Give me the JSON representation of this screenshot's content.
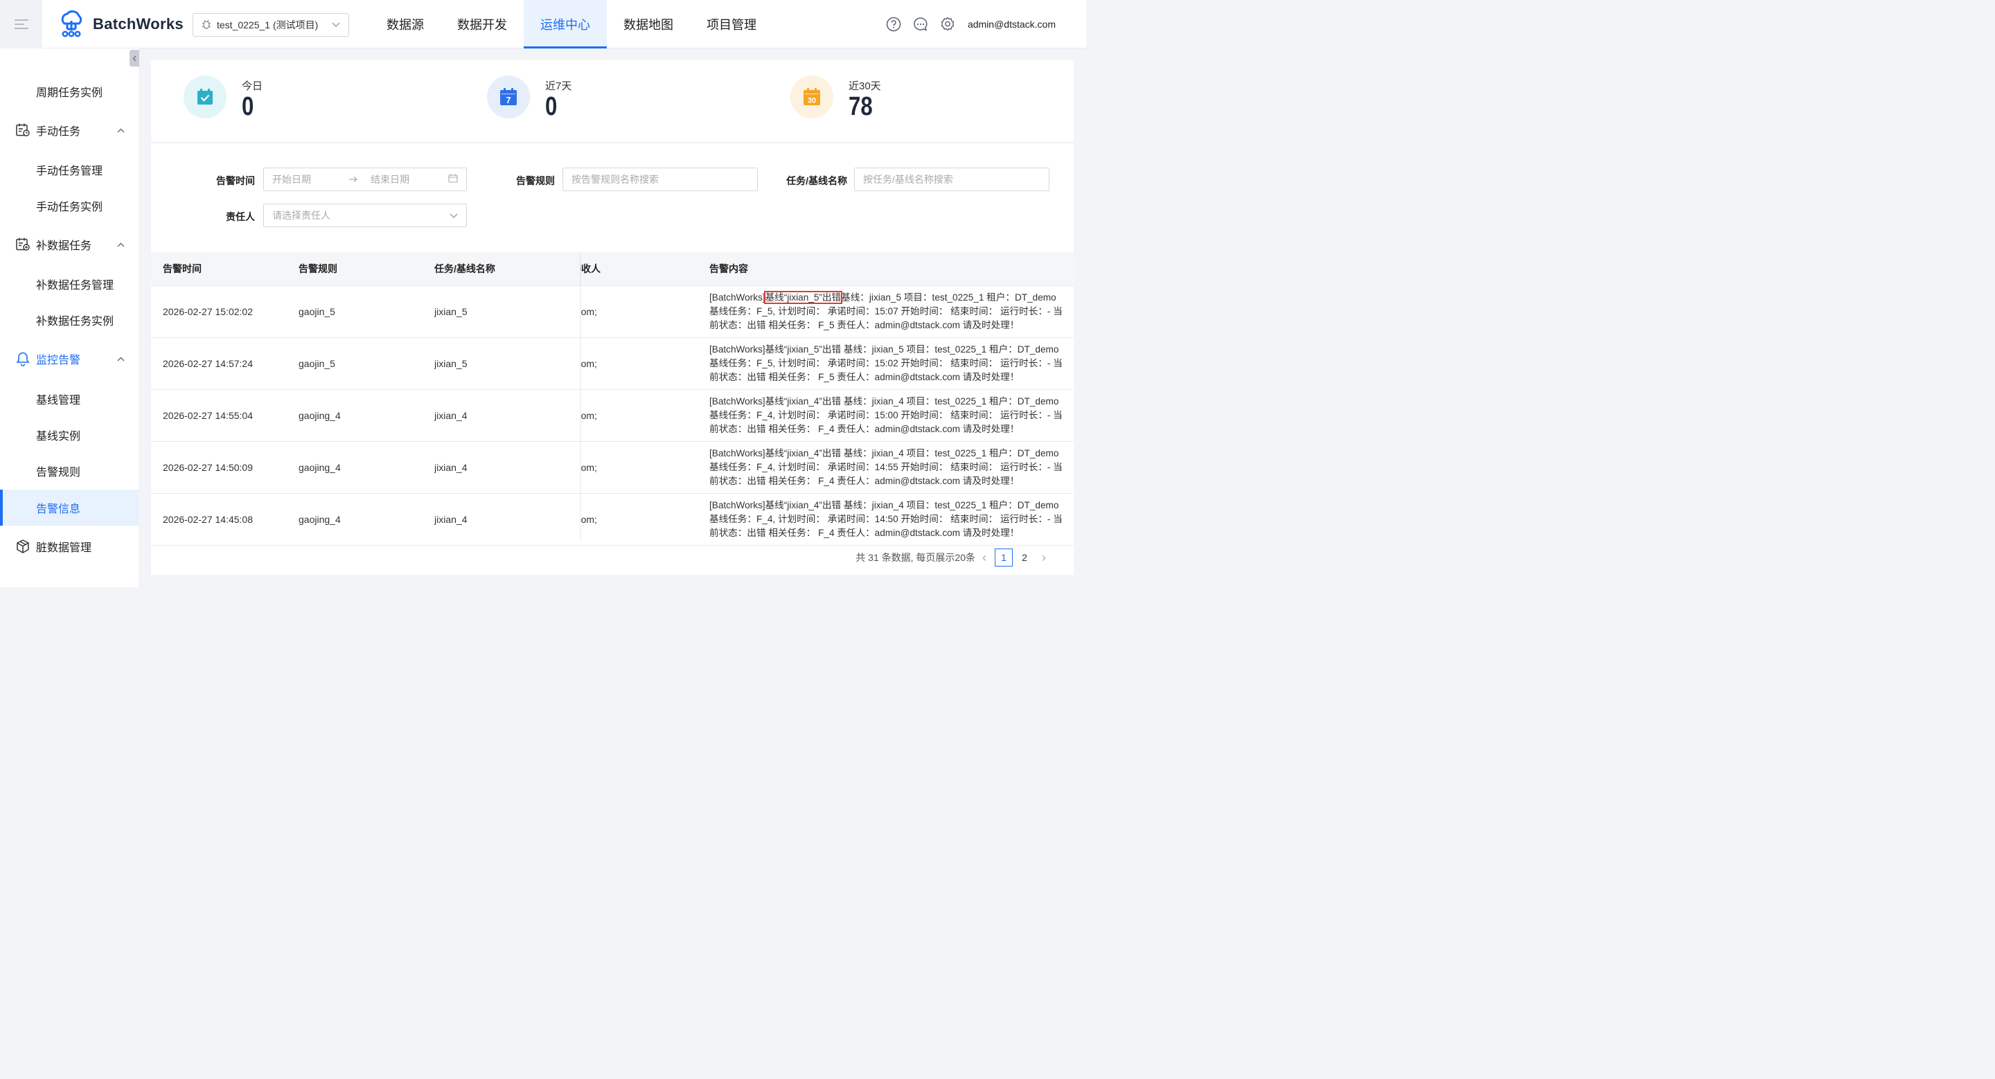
{
  "header": {
    "brand": "BatchWorks",
    "project": "test_0225_1 (测试项目)",
    "nav": [
      "数据源",
      "数据开发",
      "运维中心",
      "数据地图",
      "项目管理"
    ],
    "active_nav": "运维中心",
    "user": "admin@dtstack.com"
  },
  "sidebar": {
    "items": [
      {
        "label": "周期任务实例"
      },
      {
        "label": "手动任务"
      },
      {
        "label": "手动任务管理"
      },
      {
        "label": "手动任务实例"
      },
      {
        "label": "补数据任务"
      },
      {
        "label": "补数据任务管理"
      },
      {
        "label": "补数据任务实例"
      },
      {
        "label": "监控告警"
      },
      {
        "label": "基线管理"
      },
      {
        "label": "基线实例"
      },
      {
        "label": "告警规则"
      },
      {
        "label": "告警信息"
      },
      {
        "label": "脏数据管理"
      }
    ]
  },
  "stats": [
    {
      "label": "今日",
      "value": "0",
      "color": "#2ab1c7"
    },
    {
      "label": "近7天",
      "value": "0",
      "color": "#2f6fe6"
    },
    {
      "label": "近30天",
      "value": "78",
      "color": "#f5a623"
    }
  ],
  "filter": {
    "time_label": "告警时间",
    "start_placeholder": "开始日期",
    "end_placeholder": "结束日期",
    "rule_label": "告警规则",
    "rule_placeholder": "按告警规则名称搜索",
    "task_label": "任务/基线名称",
    "task_placeholder": "按任务/基线名称搜索",
    "owner_label": "责任人",
    "owner_placeholder": "请选择责任人"
  },
  "table": {
    "columns": [
      "告警时间",
      "告警规则",
      "任务/基线名称",
      "接收人",
      "告警内容"
    ],
    "rows": [
      {
        "time": "2026-02-27 15:02:02",
        "rule": "gaojin_5",
        "task": "jixian_5",
        "receiver": "admin@dtstack.com;",
        "content_prefix": "[BatchWorks]",
        "content_hl": "基线“jixian_5”出错",
        "content_rest": "基线：jixian_5 项目：test_0225_1 租户：DT_demo 基线任务：F_5, 计划时间： 承诺时间：15:07 开始时间： 结束时间： 运行时长：- 当前状态：出错 相关任务： F_5 责任人：admin@dtstack.com 请及时处理！"
      },
      {
        "time": "2026-02-27 14:57:24",
        "rule": "gaojin_5",
        "task": "jixian_5",
        "receiver": "admin@dtstack.com;",
        "content_prefix": "[BatchWorks]",
        "content_hl": "基线“jixian_5”出错",
        "content_rest": " 基线：jixian_5 项目：test_0225_1 租户：DT_demo 基线任务：F_5, 计划时间： 承诺时间：15:02 开始时间： 结束时间： 运行时长：- 当前状态：出错 相关任务： F_5 责任人：admin@dtstack.com 请及时处理！"
      },
      {
        "time": "2026-02-27 14:55:04",
        "rule": "gaojing_4",
        "task": "jixian_4",
        "receiver": "admin@dtstack.com;",
        "content_prefix": "[BatchWorks]",
        "content_hl": "基线“jixian_4”出错",
        "content_rest": " 基线：jixian_4 项目：test_0225_1 租户：DT_demo 基线任务：F_4, 计划时间： 承诺时间：15:00 开始时间： 结束时间： 运行时长：- 当前状态：出错 相关任务： F_4 责任人：admin@dtstack.com 请及时处理！"
      },
      {
        "time": "2026-02-27 14:50:09",
        "rule": "gaojing_4",
        "task": "jixian_4",
        "receiver": "admin@dtstack.com;",
        "content_prefix": "[BatchWorks]",
        "content_hl": "基线“jixian_4”出错",
        "content_rest": " 基线：jixian_4 项目：test_0225_1 租户：DT_demo 基线任务：F_4, 计划时间： 承诺时间：14:55 开始时间： 结束时间： 运行时长：- 当前状态：出错 相关任务： F_4 责任人：admin@dtstack.com 请及时处理！"
      },
      {
        "time": "2026-02-27 14:45:08",
        "rule": "gaojing_4",
        "task": "jixian_4",
        "receiver": "admin@dtstack.com;",
        "content_prefix": "[BatchWorks]",
        "content_hl": "基线“jixian_4”出错",
        "content_rest": " 基线：jixian_4 项目：test_0225_1 租户：DT_demo 基线任务：F_4, 计划时间： 承诺时间：14:50 开始时间： 结束时间： 运行时长：- 当前状态：出错 相关任务： F_4 责任人：admin@dtstack.com 请及时处理！"
      }
    ]
  },
  "pagination": {
    "summary": "共 31 条数据, 每页展示20条",
    "pages": [
      "1",
      "2"
    ],
    "current": "1"
  }
}
